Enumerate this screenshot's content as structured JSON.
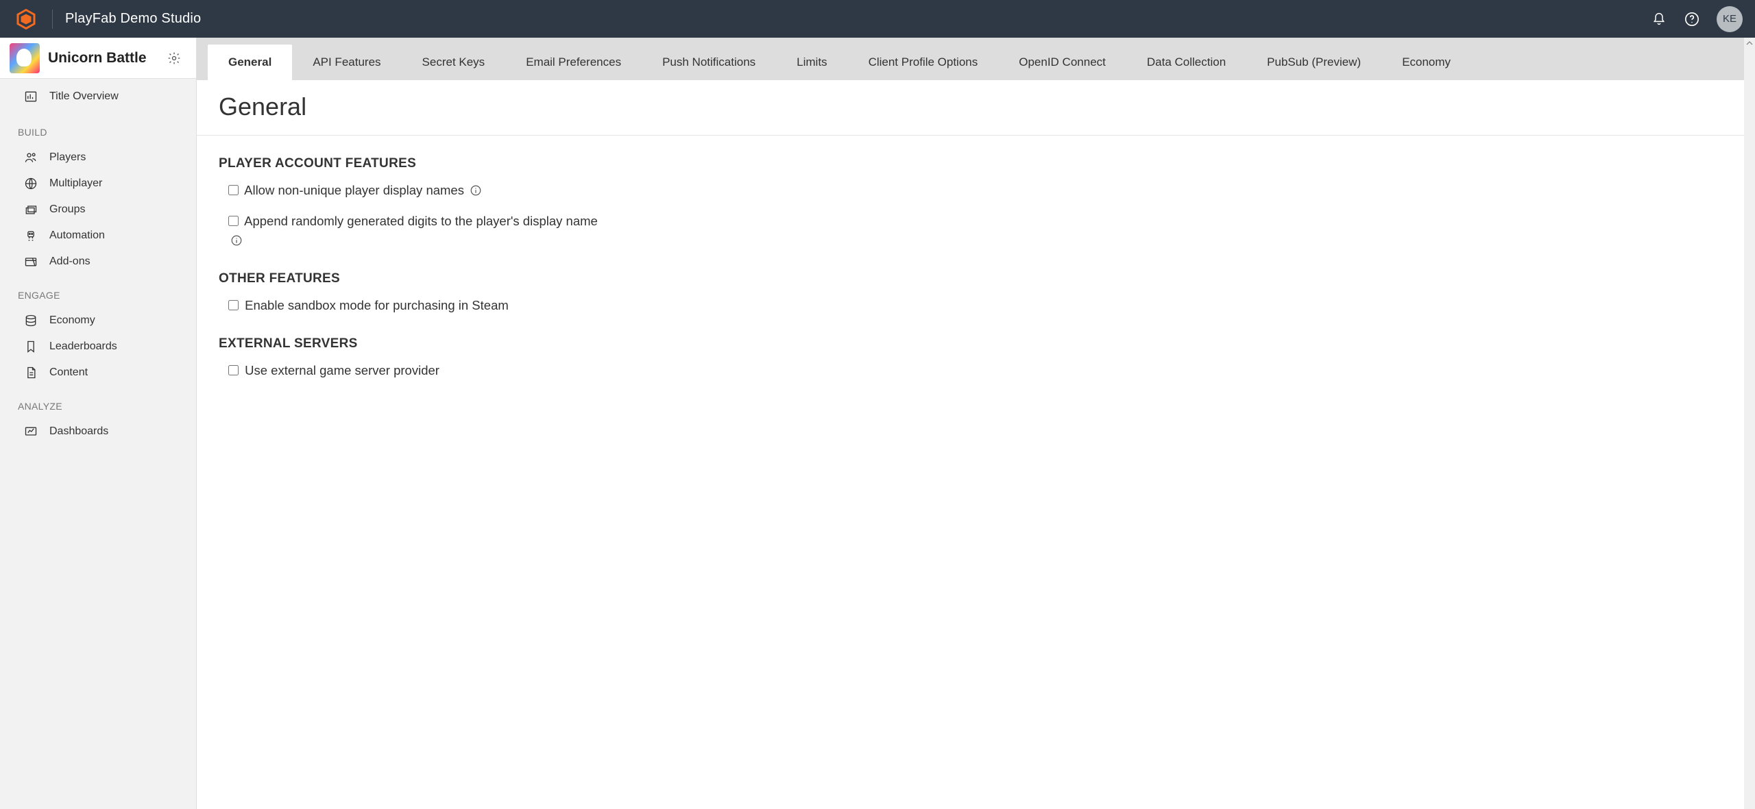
{
  "header": {
    "studio_name": "PlayFab Demo Studio",
    "avatar_initials": "KE"
  },
  "sidebar": {
    "app_name": "Unicorn Battle",
    "primary_item": {
      "label": "Title Overview"
    },
    "sections": [
      {
        "heading": "BUILD",
        "items": [
          {
            "key": "players",
            "label": "Players"
          },
          {
            "key": "multiplayer",
            "label": "Multiplayer"
          },
          {
            "key": "groups",
            "label": "Groups"
          },
          {
            "key": "automation",
            "label": "Automation"
          },
          {
            "key": "addons",
            "label": "Add-ons"
          }
        ]
      },
      {
        "heading": "ENGAGE",
        "items": [
          {
            "key": "economy",
            "label": "Economy"
          },
          {
            "key": "leaderboards",
            "label": "Leaderboards"
          },
          {
            "key": "content",
            "label": "Content"
          }
        ]
      },
      {
        "heading": "ANALYZE",
        "items": [
          {
            "key": "dashboards",
            "label": "Dashboards"
          }
        ]
      }
    ]
  },
  "tabs": [
    {
      "label": "General",
      "active": true
    },
    {
      "label": "API Features",
      "active": false
    },
    {
      "label": "Secret Keys",
      "active": false
    },
    {
      "label": "Email Preferences",
      "active": false
    },
    {
      "label": "Push Notifications",
      "active": false
    },
    {
      "label": "Limits",
      "active": false
    },
    {
      "label": "Client Profile Options",
      "active": false
    },
    {
      "label": "OpenID Connect",
      "active": false
    },
    {
      "label": "Data Collection",
      "active": false
    },
    {
      "label": "PubSub (Preview)",
      "active": false
    },
    {
      "label": "Economy",
      "active": false
    }
  ],
  "main": {
    "page_title": "General",
    "sections": [
      {
        "heading": "PLAYER ACCOUNT FEATURES",
        "options": [
          {
            "label": "Allow non-unique player display names",
            "has_info": true,
            "checked": false
          },
          {
            "label": "Append randomly generated digits to the player's display name",
            "has_info": true,
            "checked": false
          }
        ]
      },
      {
        "heading": "OTHER FEATURES",
        "options": [
          {
            "label": "Enable sandbox mode for purchasing in Steam",
            "has_info": false,
            "checked": false
          }
        ]
      },
      {
        "heading": "EXTERNAL SERVERS",
        "options": [
          {
            "label": "Use external game server provider",
            "has_info": false,
            "checked": false
          }
        ]
      }
    ]
  }
}
